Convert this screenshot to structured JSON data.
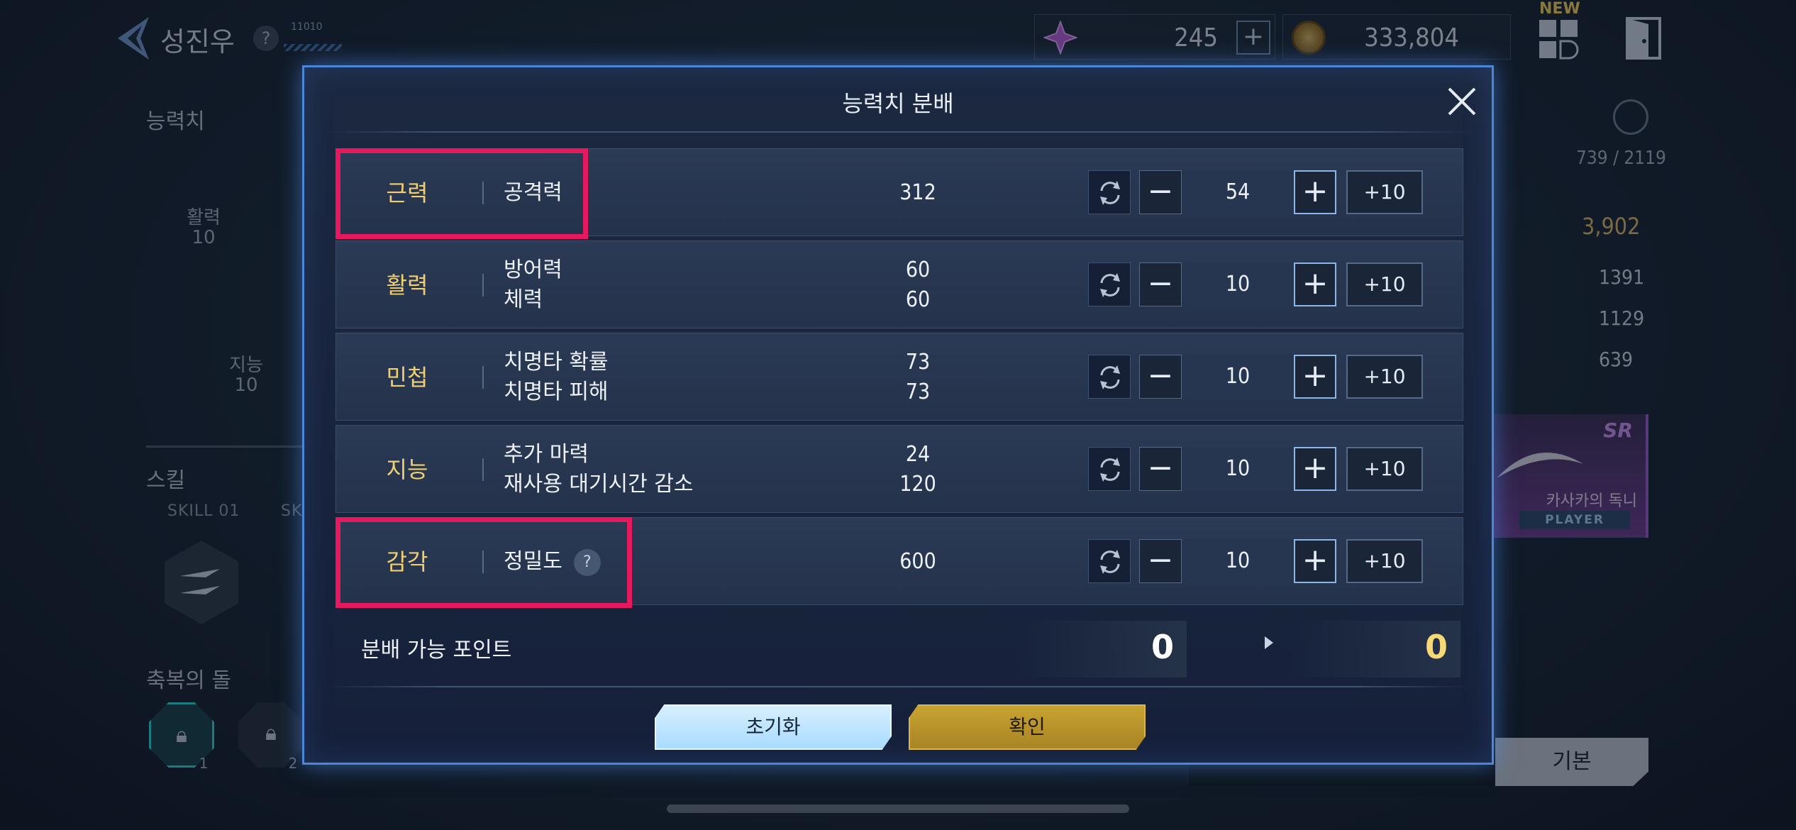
{
  "background": {
    "player_name": "성진우",
    "help_mark": "?",
    "level_code": "11010",
    "currency": {
      "gem_value": "245",
      "gold_value": "333,804",
      "plus": "+"
    },
    "new_badge": "NEW",
    "left": {
      "stats_title": "능력치",
      "vitality_label": "활력",
      "vitality_value": "10",
      "intelligence_label": "지능",
      "intelligence_value": "10",
      "skills_title": "스킬",
      "skill_01_label": "SKILL 01",
      "skill_02_label": "SK",
      "blessing_title": "축복의 돌",
      "stone_1_num": "1",
      "stone_2_num": "2"
    },
    "right": {
      "exp_value": "739 / 2119",
      "power_value": "3,902",
      "stat_value_1": "1391",
      "stat_value_2": "1129",
      "stat_value_3": "639",
      "card_rank": "SR",
      "card_name": "카사카의 독니",
      "card_tag": "PLAYER",
      "tab_basic": "기본"
    }
  },
  "modal": {
    "title": "능력치 분배",
    "rows": [
      {
        "stat": "근력",
        "subs": [
          "공격력"
        ],
        "values": [
          "312"
        ],
        "alloc": "54"
      },
      {
        "stat": "활력",
        "subs": [
          "방어력",
          "체력"
        ],
        "values": [
          "60",
          "60"
        ],
        "alloc": "10"
      },
      {
        "stat": "민첩",
        "subs": [
          "치명타 확률",
          "치명타 피해"
        ],
        "values": [
          "73",
          "73"
        ],
        "alloc": "10"
      },
      {
        "stat": "지능",
        "subs": [
          "추가 마력",
          "재사용 대기시간 감소"
        ],
        "values": [
          "24",
          "120"
        ],
        "alloc": "10"
      },
      {
        "stat": "감각",
        "subs": [
          "정밀도"
        ],
        "values": [
          "600"
        ],
        "alloc": "10"
      }
    ],
    "controls": {
      "minus": "−",
      "plus": "+",
      "plus10": "+10",
      "help": "?"
    },
    "points": {
      "label": "분배 가능 포인트",
      "current": "0",
      "after": "0"
    },
    "buttons": {
      "reset": "초기화",
      "confirm": "확인"
    }
  },
  "colors": {
    "stat_name": "#f0cf73",
    "highlight": "#e6195e",
    "points_after": "#f6d877",
    "modal_border": "#4c86d8"
  }
}
